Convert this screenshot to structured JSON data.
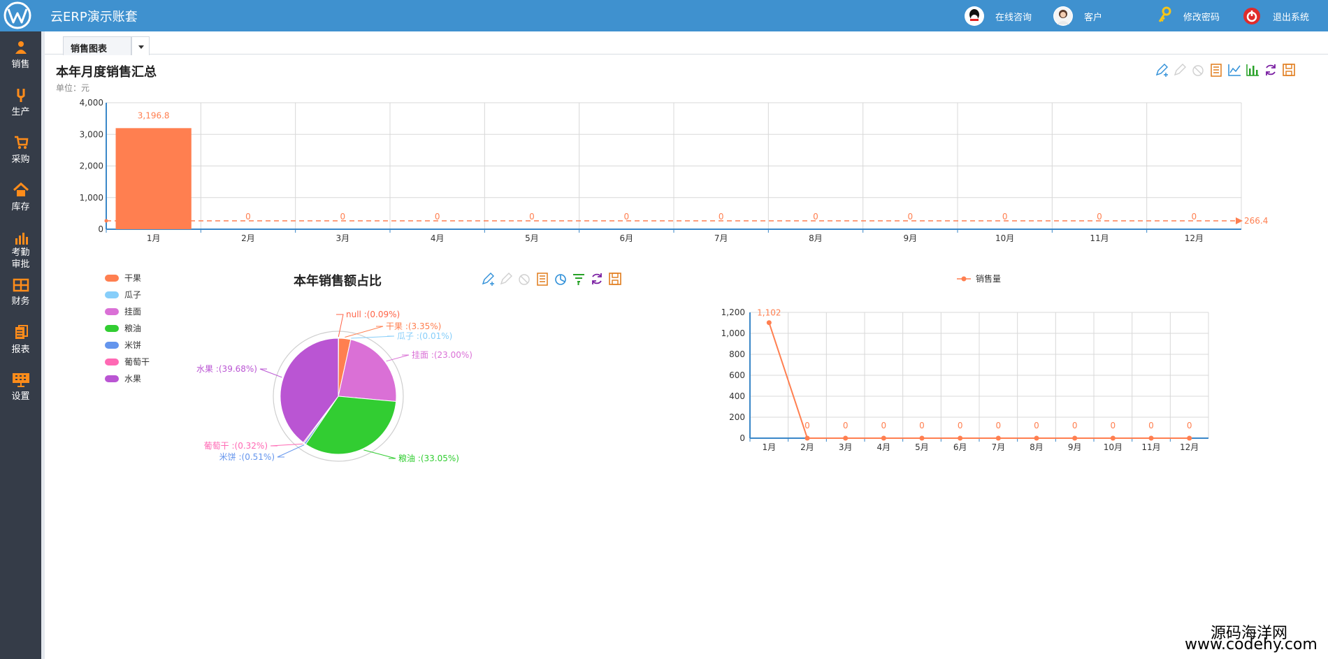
{
  "header": {
    "title": "云ERP演示账套",
    "items": [
      {
        "label": "在线咨询",
        "icon": "qq-icon"
      },
      {
        "label": "客户",
        "icon": "customer-avatar"
      },
      {
        "label": "修改密码",
        "icon": "key-icon"
      },
      {
        "label": "退出系统",
        "icon": "power-icon"
      }
    ]
  },
  "sidebar": {
    "items": [
      {
        "label": "销售",
        "icon": "sales-icon"
      },
      {
        "label": "生产",
        "icon": "production-icon"
      },
      {
        "label": "采购",
        "icon": "cart-icon"
      },
      {
        "label": "库存",
        "icon": "home-icon"
      },
      {
        "label": "考勤",
        "label2": "审批",
        "icon": "attendance-icon"
      },
      {
        "label": "财务",
        "icon": "finance-icon"
      },
      {
        "label": "报表",
        "icon": "report-icon"
      },
      {
        "label": "设置",
        "icon": "settings-icon"
      }
    ]
  },
  "tabs": {
    "active": "销售图表"
  },
  "colors": {
    "topbar": "#3f91cf",
    "sidebar": "#353c48",
    "accent": "#ff7f50"
  },
  "chart_data": [
    {
      "type": "bar",
      "title": "本年月度销售汇总",
      "subtitle": "单位：元",
      "categories": [
        "1月",
        "2月",
        "3月",
        "4月",
        "5月",
        "6月",
        "7月",
        "8月",
        "9月",
        "10月",
        "11月",
        "12月"
      ],
      "values": [
        3196.8,
        0,
        0,
        0,
        0,
        0,
        0,
        0,
        0,
        0,
        0,
        0
      ],
      "value_labels": [
        "3,196.8",
        "0",
        "0",
        "0",
        "0",
        "0",
        "0",
        "0",
        "0",
        "0",
        "0",
        "0"
      ],
      "ylim": [
        0,
        4000
      ],
      "yticks": [
        "0",
        "1,000",
        "2,000",
        "3,000",
        "4,000"
      ],
      "average_line": {
        "value": 266.4,
        "label": "266.4"
      },
      "grid": true,
      "color": "#ff7f50"
    },
    {
      "type": "pie",
      "title": "本年销售额占比",
      "legend_position": "left",
      "slices": [
        {
          "name": "null",
          "value": 0.09,
          "label": "null :(0.09%)",
          "color": "#ff6347",
          "in_legend": false
        },
        {
          "name": "干果",
          "value": 3.35,
          "label": "干果 :(3.35%)",
          "color": "#ff7f50",
          "in_legend": true
        },
        {
          "name": "瓜子",
          "value": 0.01,
          "label": "瓜子 :(0.01%)",
          "color": "#87cefa",
          "in_legend": true
        },
        {
          "name": "挂面",
          "value": 23.0,
          "label": "挂面 :(23.00%)",
          "color": "#da70d6",
          "in_legend": true
        },
        {
          "name": "粮油",
          "value": 33.05,
          "label": "粮油 :(33.05%)",
          "color": "#32cd32",
          "in_legend": true
        },
        {
          "name": "米饼",
          "value": 0.51,
          "label": "米饼 :(0.51%)",
          "color": "#6495ed",
          "in_legend": true
        },
        {
          "name": "葡萄干",
          "value": 0.32,
          "label": "葡萄干 :(0.32%)",
          "color": "#ff69b4",
          "in_legend": true
        },
        {
          "name": "水果",
          "value": 39.68,
          "label": "水果 :(39.68%)",
          "color": "#ba55d3",
          "in_legend": true
        }
      ]
    },
    {
      "type": "line",
      "legend": "销售量",
      "categories": [
        "1月",
        "2月",
        "3月",
        "4月",
        "5月",
        "6月",
        "7月",
        "8月",
        "9月",
        "10月",
        "11月",
        "12月"
      ],
      "values": [
        1102,
        0,
        0,
        0,
        0,
        0,
        0,
        0,
        0,
        0,
        0,
        0
      ],
      "value_labels": [
        "1,102",
        "0",
        "0",
        "0",
        "0",
        "0",
        "0",
        "0",
        "0",
        "0",
        "0",
        "0"
      ],
      "ylim": [
        0,
        1200
      ],
      "yticks": [
        "0",
        "200",
        "400",
        "600",
        "800",
        "1,000",
        "1,200"
      ],
      "grid": true,
      "color": "#ff7f50"
    }
  ],
  "watermark": {
    "line1": "源码海洋网",
    "line2": "www.codehy.com"
  }
}
